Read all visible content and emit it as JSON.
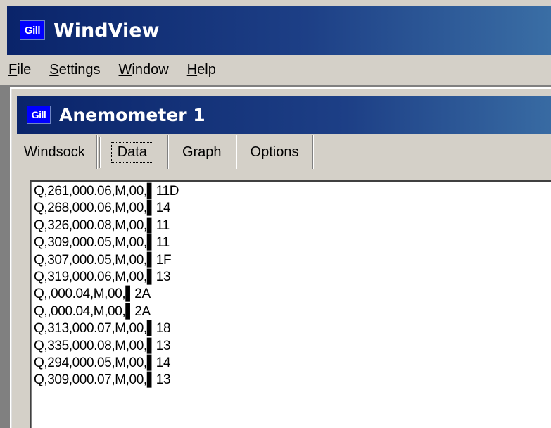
{
  "app": {
    "title": "WindView",
    "icon_text": "Gill"
  },
  "menu": {
    "items": [
      {
        "first": "F",
        "rest": "ile"
      },
      {
        "first": "S",
        "rest": "ettings"
      },
      {
        "first": "W",
        "rest": "indow"
      },
      {
        "first": "H",
        "rest": "elp"
      }
    ]
  },
  "child": {
    "title": "Anemometer 1",
    "icon_text": "Gill"
  },
  "tabs": [
    {
      "label": "Windsock"
    },
    {
      "label": "Data"
    },
    {
      "label": "Graph"
    },
    {
      "label": "Options"
    }
  ],
  "data_lines": [
    "Q,261,000.06,M,00,\u000211D",
    "Q,268,000.06,M,00,\u000214",
    "Q,326,000.08,M,00,\u000211",
    "Q,309,000.05,M,00,\u000211",
    "Q,307,000.05,M,00,\u00021F",
    "Q,319,000.06,M,00,\u000213",
    "Q,,000.04,M,00,\u00022A",
    "Q,,000.04,M,00,\u00022A",
    "Q,313,000.07,M,00,\u000218",
    "Q,335,000.08,M,00,\u000213",
    "Q,294,000.05,M,00,\u000214",
    "Q,309,000.07,M,00,\u000213"
  ],
  "colors": {
    "titlebar_start": "#0a246a",
    "titlebar_end": "#3a6ea5",
    "face": "#d4d0c8",
    "icon_bg": "#0000ff"
  }
}
